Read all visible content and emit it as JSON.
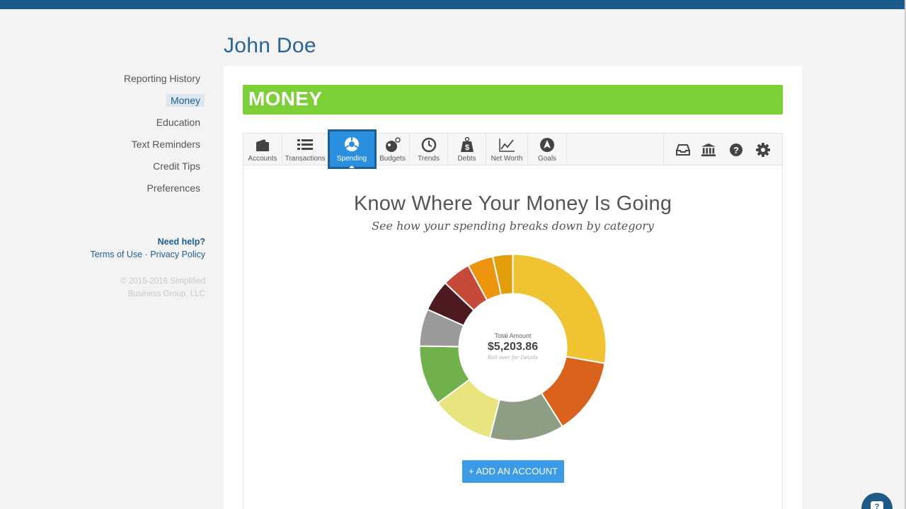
{
  "user": {
    "name": "John Doe"
  },
  "sidebar": {
    "items": [
      {
        "label": "Reporting History",
        "active": false
      },
      {
        "label": "Money",
        "active": true
      },
      {
        "label": "Education",
        "active": false
      },
      {
        "label": "Text Reminders",
        "active": false
      },
      {
        "label": "Credit Tips",
        "active": false
      },
      {
        "label": "Preferences",
        "active": false
      }
    ],
    "help_title": "Need help?",
    "terms_label": "Terms of Use",
    "separator": " · ",
    "privacy_label": "Privacy Policy",
    "copyright_line1": "© 2015-2016 Simplified",
    "copyright_line2": "Business Group, LLC"
  },
  "money": {
    "banner_title": "MONEY",
    "tabs": [
      {
        "label": "Accounts",
        "icon": "wallet-icon"
      },
      {
        "label": "Transactions",
        "icon": "list-icon"
      },
      {
        "label": "Spending",
        "icon": "pie-chart-icon",
        "active": true
      },
      {
        "label": "Budgets",
        "icon": "bomb-icon"
      },
      {
        "label": "Trends",
        "icon": "clock-icon"
      },
      {
        "label": "Debts",
        "icon": "weight-icon"
      },
      {
        "label": "Net Worth",
        "icon": "line-chart-icon"
      },
      {
        "label": "Goals",
        "icon": "compass-icon"
      }
    ],
    "tool_icons": [
      "inbox-icon",
      "bank-icon",
      "help-icon",
      "gear-icon"
    ],
    "headline": "Know Where Your Money Is Going",
    "subheadline": "See how your spending breaks down by category",
    "total_label": "Total Amount",
    "total_amount": "$5,203.86",
    "total_hint": "Roll over for Details",
    "add_account_label": "+ ADD AN ACCOUNT"
  },
  "chart_data": {
    "type": "pie",
    "title": "",
    "slices": [
      {
        "value": 28.0,
        "color": "#f0c332"
      },
      {
        "value": 13.5,
        "color": "#d9621c"
      },
      {
        "value": 13.0,
        "color": "#8e9e84"
      },
      {
        "value": 11.0,
        "color": "#e8e47e"
      },
      {
        "value": 10.5,
        "color": "#70b14b"
      },
      {
        "value": 6.5,
        "color": "#9a9a9a"
      },
      {
        "value": 5.5,
        "color": "#4c1a1f"
      },
      {
        "value": 5.0,
        "color": "#c64a3a"
      },
      {
        "value": 4.5,
        "color": "#ee950f"
      },
      {
        "value": 3.5,
        "color": "#e29d0a"
      }
    ]
  },
  "colors": {
    "topbar": "#1b5b8c",
    "banner": "#7dcf38",
    "active_tab": "#2b8fe0",
    "button": "#3c9be6"
  }
}
